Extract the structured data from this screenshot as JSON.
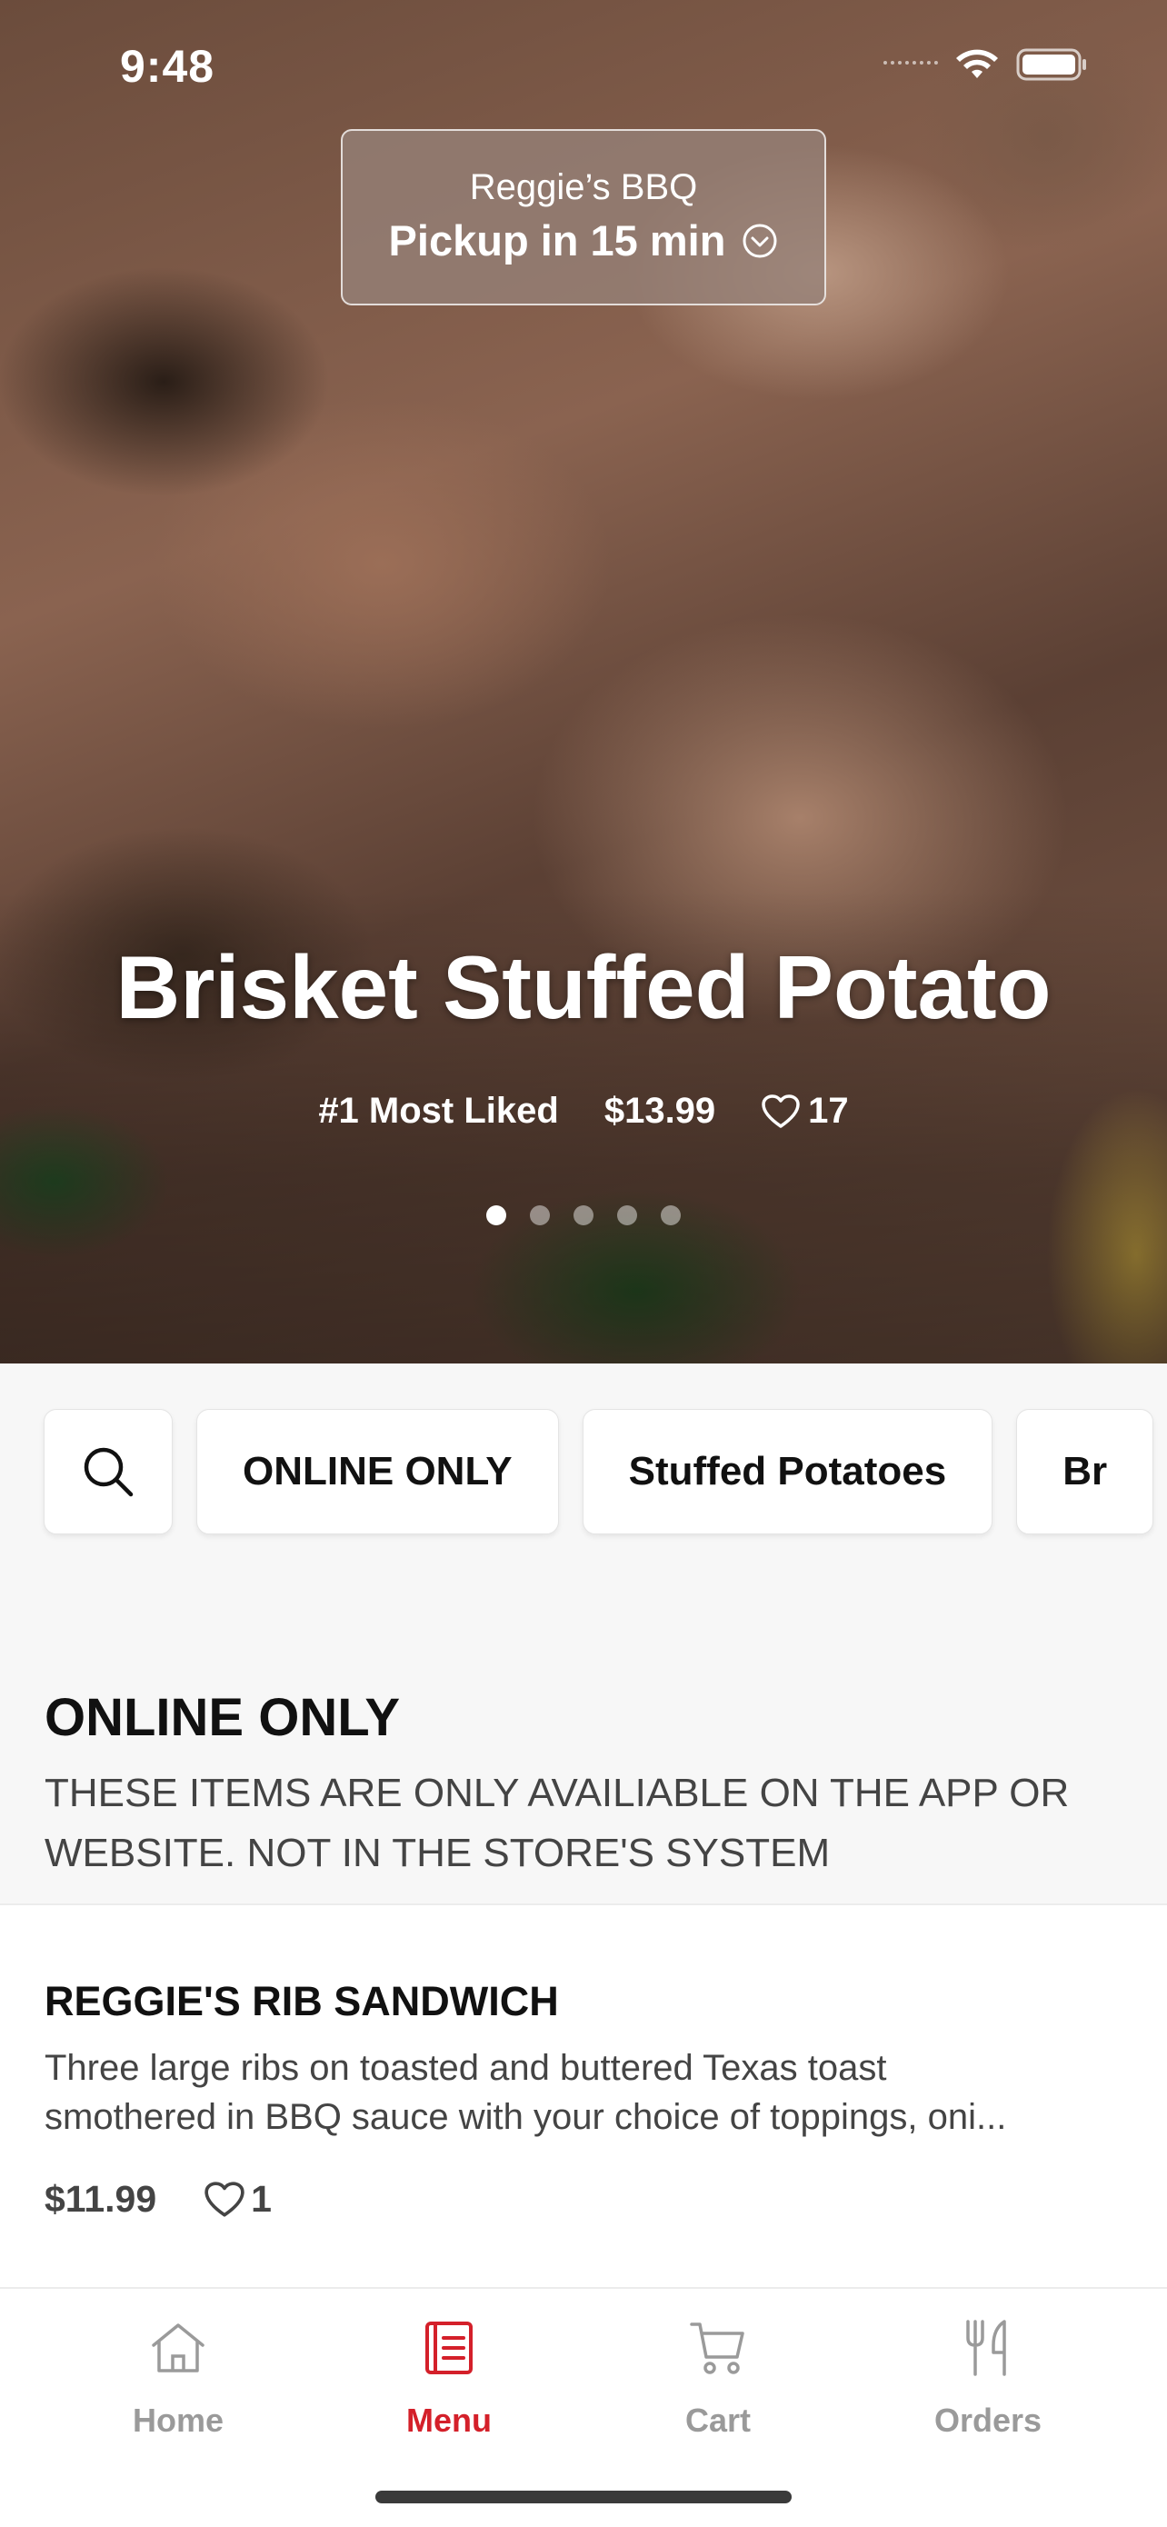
{
  "status": {
    "time": "9:48",
    "icons": [
      "cellular-dots-icon",
      "wifi-icon",
      "battery-icon"
    ]
  },
  "store": {
    "name": "Reggie’s BBQ",
    "pickup": "Pickup in 15 min",
    "chevron": "chevron-down-circle-icon"
  },
  "hero": {
    "title": "Brisket Stuffed Potato",
    "badge": "#1 Most Liked",
    "price": "$13.99",
    "likes": "17",
    "pager": {
      "count": 5,
      "active": 1
    }
  },
  "categories": {
    "search_icon": "search-icon",
    "items": [
      "ONLINE ONLY",
      "Stuffed Potatoes",
      "Br"
    ]
  },
  "section": {
    "title": "ONLINE ONLY",
    "description": "THESE ITEMS ARE ONLY AVAILIABLE ON THE APP OR WEBSITE. NOT IN THE STORE'S SYSTEM"
  },
  "menu_item": {
    "name": "REGGIE'S RIB SANDWICH",
    "desc_line1": "Three large ribs on toasted and buttered Texas toast",
    "desc_line2": "smothered in BBQ sauce with your choice of toppings, oni...",
    "price": "$11.99",
    "likes": "1"
  },
  "tabs": [
    {
      "label": "Home",
      "icon": "home-icon"
    },
    {
      "label": "Menu",
      "icon": "menu-icon",
      "active": true
    },
    {
      "label": "Cart",
      "icon": "cart-icon"
    },
    {
      "label": "Orders",
      "icon": "fork-knife-icon"
    }
  ],
  "colors": {
    "accent": "#d4202a",
    "inactive": "#9a9a9a",
    "background": "#f7f7f7"
  }
}
